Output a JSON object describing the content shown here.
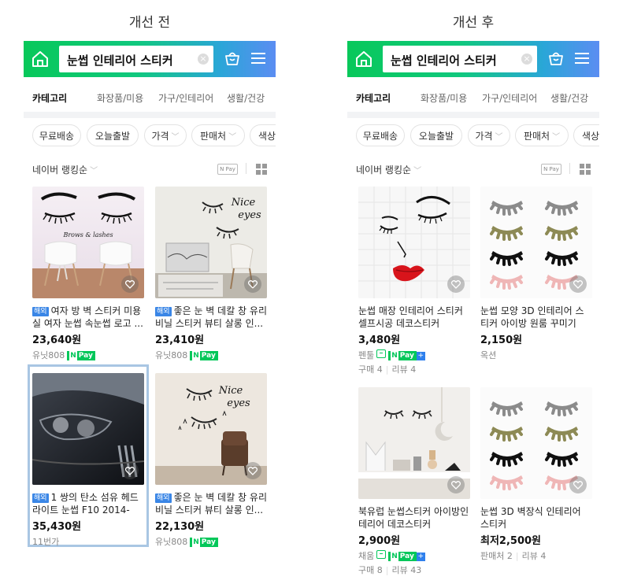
{
  "before": {
    "panel_title": "개선 전",
    "search_query": "눈썹 인테리어 스티커",
    "categories": [
      "카테고리",
      "화장품/미용",
      "가구/인테리어",
      "생활/건강"
    ],
    "filters": [
      "무료배송",
      "오늘출발",
      "가격",
      "판매처",
      "색상"
    ],
    "sort_label": "네이버 랭킹순",
    "npay_filter_label": "N Pay",
    "products": [
      {
        "tag": "해외",
        "title": "여자 방 벽 스티커 미용실 여자 눈썹 속눈썹 로고 ...",
        "price": "23,640원",
        "seller": "유닛808"
      },
      {
        "tag": "해외",
        "title": "좋은 눈 벽 데칼 창 유리 비닐 스티커 뷰티 살롱 인...",
        "price": "23,410원",
        "seller": "유닛808"
      },
      {
        "tag": "해외",
        "title": "1 쌍의 탄소 섬유 헤드 라이트 눈썹 F10 2014-2...",
        "price": "35,430원",
        "seller": "11번가"
      },
      {
        "tag": "해외",
        "title": "좋은 눈 벽 데칼 창 유리 비닐 스티커 뷰티 살롱 인...",
        "price": "22,130원",
        "seller": "유닛808"
      }
    ],
    "image_texts": {
      "brows": "Brows & lashes",
      "nice": "Nice",
      "eyes": "eyes"
    }
  },
  "after": {
    "panel_title": "개선 후",
    "search_query": "눈썹 인테리어 스티커",
    "categories": [
      "카테고리",
      "화장품/미용",
      "가구/인테리어",
      "생활/건강"
    ],
    "filters": [
      "무료배송",
      "오늘출발",
      "가격",
      "판매처",
      "색상"
    ],
    "sort_label": "네이버 랭킹순",
    "npay_filter_label": "N Pay",
    "products": [
      {
        "title": "눈썹 매장 인테리어 스티커 셀프시공 데코스티커",
        "price": "3,480원",
        "seller": "펜툴",
        "stats": [
          "구매 4",
          "리뷰 4"
        ]
      },
      {
        "title": "눈썹 모양 3D 인테리어 스티커 아이방 원룸 꾸미기",
        "price": "2,150원",
        "seller": "옥션"
      },
      {
        "title": "북유럽 눈썹스티커 아이방인테리어 데코스티커",
        "price": "2,900원",
        "seller": "채움",
        "stats": [
          "구매 8",
          "리뷰 43"
        ]
      },
      {
        "title": "눈썹 3D 벽장식 인테리어 스티커",
        "price": "최저2,500원",
        "seller": "",
        "stats": [
          "판매처 2",
          "리뷰 4"
        ]
      }
    ]
  },
  "npay_text": "Pay",
  "npay_n": "N",
  "clear_symbol": "×",
  "chevron": "﹀",
  "colors": {
    "accent_green": "#03c75a",
    "overseas_tag": "#3a86e6",
    "selected_outline": "#a9c6e3"
  }
}
